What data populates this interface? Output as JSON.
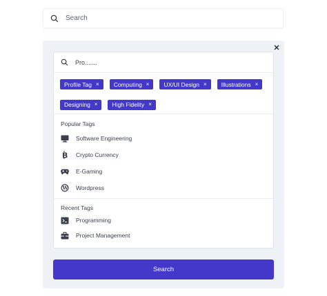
{
  "top_search": {
    "placeholder": "Search"
  },
  "panel": {
    "close_icon": "close-icon",
    "search_value": "Pro.......",
    "tags": [
      {
        "label": "Profile Tag"
      },
      {
        "label": "Computing"
      },
      {
        "label": "UX/UI Design"
      },
      {
        "label": "Illustrations"
      },
      {
        "label": "Designing"
      },
      {
        "label": "High Fidelity"
      }
    ],
    "tag_remove_glyph": "×",
    "popular": {
      "title": "Popular Tags",
      "items": [
        {
          "label": "Software Engineering",
          "icon": "monitor-icon"
        },
        {
          "label": "Crypto Currency",
          "icon": "bitcoin-icon"
        },
        {
          "label": "E-Gaming",
          "icon": "gamepad-icon"
        },
        {
          "label": "Wordpress",
          "icon": "wordpress-icon"
        }
      ]
    },
    "recent": {
      "title": "Recent Tags",
      "items": [
        {
          "label": "Programming",
          "icon": "terminal-icon"
        },
        {
          "label": "Project Management",
          "icon": "briefcase-icon"
        }
      ]
    },
    "submit_label": "Search"
  },
  "colors": {
    "accent": "#4338ca",
    "panel_bg": "#eef1f6",
    "text": "#3a3f4b"
  }
}
